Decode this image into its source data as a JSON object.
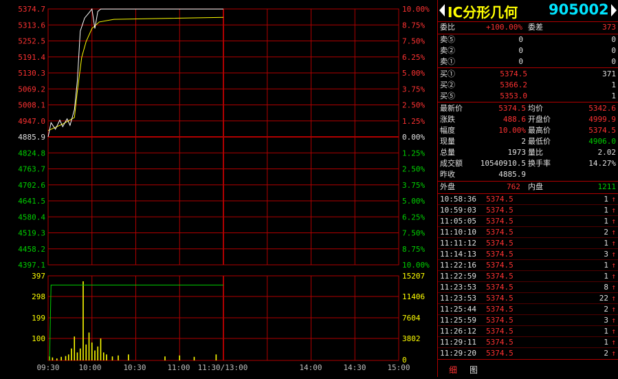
{
  "price_axis": {
    "left": [
      "5374.7",
      "5313.6",
      "5252.5",
      "5191.4",
      "5130.3",
      "5069.2",
      "5008.1",
      "4947.0",
      "4885.9",
      "4824.8",
      "4763.7",
      "4702.6",
      "4641.5",
      "4580.4",
      "4519.3",
      "4458.2",
      "4397.1"
    ],
    "right": [
      "10.00%",
      "8.75%",
      "7.50%",
      "6.25%",
      "5.00%",
      "3.75%",
      "2.50%",
      "1.25%",
      "0.00%",
      "1.25%",
      "2.50%",
      "3.75%",
      "5.00%",
      "6.25%",
      "7.50%",
      "8.75%",
      "10.00%"
    ]
  },
  "volume_axis": {
    "left": [
      "397",
      "298",
      "199",
      "100"
    ],
    "right": [
      "15207",
      "11406",
      "7604",
      "3802",
      "0"
    ]
  },
  "time_axis": [
    "09:30",
    "10:00",
    "10:30",
    "11:00",
    "11:30/13:00",
    "14:00",
    "14:30",
    "15:00"
  ],
  "chart_data": {
    "type": "line",
    "price_series": [
      {
        "time": "09:30",
        "price": 4885.9
      },
      {
        "time": "09:32",
        "price": 4940.0
      },
      {
        "time": "09:35",
        "price": 4915.0
      },
      {
        "time": "09:38",
        "price": 4950.0
      },
      {
        "time": "09:40",
        "price": 4925.0
      },
      {
        "time": "09:43",
        "price": 4955.0
      },
      {
        "time": "09:45",
        "price": 4930.0
      },
      {
        "time": "09:48",
        "price": 4990.0
      },
      {
        "time": "09:50",
        "price": 5100.0
      },
      {
        "time": "09:52",
        "price": 5290.0
      },
      {
        "time": "09:55",
        "price": 5340.0
      },
      {
        "time": "09:58",
        "price": 5360.0
      },
      {
        "time": "10:00",
        "price": 5374.5
      },
      {
        "time": "10:02",
        "price": 5300.0
      },
      {
        "time": "10:04",
        "price": 5365.0
      },
      {
        "time": "10:06",
        "price": 5374.5
      },
      {
        "time": "10:10",
        "price": 5374.5
      },
      {
        "time": "11:30",
        "price": 5374.5
      }
    ],
    "avg_series": [
      {
        "time": "09:30",
        "price": 4910.0
      },
      {
        "time": "09:40",
        "price": 4935.0
      },
      {
        "time": "09:48",
        "price": 4960.0
      },
      {
        "time": "09:50",
        "price": 5060.0
      },
      {
        "time": "09:53",
        "price": 5190.0
      },
      {
        "time": "09:56",
        "price": 5250.0
      },
      {
        "time": "10:00",
        "price": 5300.0
      },
      {
        "time": "10:05",
        "price": 5325.0
      },
      {
        "time": "10:15",
        "price": 5335.0
      },
      {
        "time": "11:30",
        "price": 5342.6
      }
    ],
    "volume_bars": [
      {
        "time": "09:31",
        "vol": 20
      },
      {
        "time": "09:33",
        "vol": 15
      },
      {
        "time": "09:36",
        "vol": 10
      },
      {
        "time": "09:39",
        "vol": 18
      },
      {
        "time": "09:42",
        "vol": 22
      },
      {
        "time": "09:44",
        "vol": 30
      },
      {
        "time": "09:46",
        "vol": 60
      },
      {
        "time": "09:48",
        "vol": 120
      },
      {
        "time": "09:50",
        "vol": 40
      },
      {
        "time": "09:52",
        "vol": 60
      },
      {
        "time": "09:54",
        "vol": 397
      },
      {
        "time": "09:56",
        "vol": 80
      },
      {
        "time": "09:58",
        "vol": 140
      },
      {
        "time": "10:00",
        "vol": 90
      },
      {
        "time": "10:02",
        "vol": 50
      },
      {
        "time": "10:04",
        "vol": 70
      },
      {
        "time": "10:06",
        "vol": 110
      },
      {
        "time": "10:08",
        "vol": 40
      },
      {
        "time": "10:10",
        "vol": 30
      },
      {
        "time": "10:14",
        "vol": 20
      },
      {
        "time": "10:18",
        "vol": 25
      },
      {
        "time": "10:25",
        "vol": 30
      },
      {
        "time": "10:50",
        "vol": 20
      },
      {
        "time": "11:00",
        "vol": 25
      },
      {
        "time": "11:10",
        "vol": 18
      },
      {
        "time": "11:25",
        "vol": 30
      }
    ],
    "cumvol_series": [
      {
        "time": "09:31",
        "cv": 0
      },
      {
        "time": "09:32",
        "cv": 14500
      },
      {
        "time": "11:30",
        "cv": 14500
      }
    ],
    "ylim": [
      4397.1,
      5374.7
    ],
    "vol_ylim": [
      0,
      397
    ]
  },
  "panel": {
    "name": "IC分形几何",
    "code": "905002",
    "weibi": {
      "label": "委比",
      "value": "+100.00%",
      "label2": "委差",
      "value2": "373"
    },
    "sell": [
      {
        "label": "卖⑤",
        "price": "0",
        "vol": "0"
      },
      {
        "label": "卖②",
        "price": "0",
        "vol": "0"
      },
      {
        "label": "卖①",
        "price": "0",
        "vol": "0"
      }
    ],
    "buy": [
      {
        "label": "买①",
        "price": "5374.5",
        "vol": "371"
      },
      {
        "label": "买②",
        "price": "5366.2",
        "vol": "1"
      },
      {
        "label": "买⑤",
        "price": "5353.0",
        "vol": "1"
      }
    ],
    "stats": [
      {
        "l1": "最新价",
        "v1": "5374.5",
        "l2": "均价",
        "v2": "5342.6"
      },
      {
        "l1": "涨跌",
        "v1": "488.6",
        "l2": "开盘价",
        "v2": "4999.9"
      },
      {
        "l1": "幅度",
        "v1": "10.00%",
        "l2": "最高价",
        "v2": "5374.5"
      },
      {
        "l1": "现量",
        "v1": "2",
        "l2": "最低价",
        "v2": "4906.0"
      },
      {
        "l1": "总量",
        "v1": "1973",
        "l2": "量比",
        "v2": "2.02"
      },
      {
        "l1": "成交额",
        "v1": "10540910.5",
        "l2": "换手率",
        "v2": "14.27%"
      },
      {
        "l1": "昨收",
        "v1": "4885.9",
        "l2": "",
        "v2": ""
      }
    ],
    "outer": {
      "label": "外盘",
      "value": "762",
      "label2": "内盘",
      "value2": "1211"
    },
    "trades": [
      {
        "t": "10:58:36",
        "p": "5374.5",
        "v": "1"
      },
      {
        "t": "10:59:03",
        "p": "5374.5",
        "v": "1"
      },
      {
        "t": "11:05:05",
        "p": "5374.5",
        "v": "1"
      },
      {
        "t": "11:10:10",
        "p": "5374.5",
        "v": "2"
      },
      {
        "t": "11:11:12",
        "p": "5374.5",
        "v": "1"
      },
      {
        "t": "11:14:13",
        "p": "5374.5",
        "v": "3"
      },
      {
        "t": "11:22:16",
        "p": "5374.5",
        "v": "1"
      },
      {
        "t": "11:22:59",
        "p": "5374.5",
        "v": "1"
      },
      {
        "t": "11:23:53",
        "p": "5374.5",
        "v": "8"
      },
      {
        "t": "11:23:53",
        "p": "5374.5",
        "v": "22"
      },
      {
        "t": "11:25:44",
        "p": "5374.5",
        "v": "2"
      },
      {
        "t": "11:25:59",
        "p": "5374.5",
        "v": "3"
      },
      {
        "t": "11:26:12",
        "p": "5374.5",
        "v": "1"
      },
      {
        "t": "11:29:11",
        "p": "5374.5",
        "v": "1"
      },
      {
        "t": "11:29:20",
        "p": "5374.5",
        "v": "2"
      }
    ],
    "trade_arrow": "↑",
    "tabs": [
      "细",
      "图"
    ]
  },
  "colors": {
    "up": "#ff3232",
    "down": "#00d000",
    "grid": "#b00000",
    "price_line": "#ffffff",
    "avg_line": "#ffff00",
    "vol_bar": "#ffff00",
    "cumvol_line": "#00d000"
  }
}
